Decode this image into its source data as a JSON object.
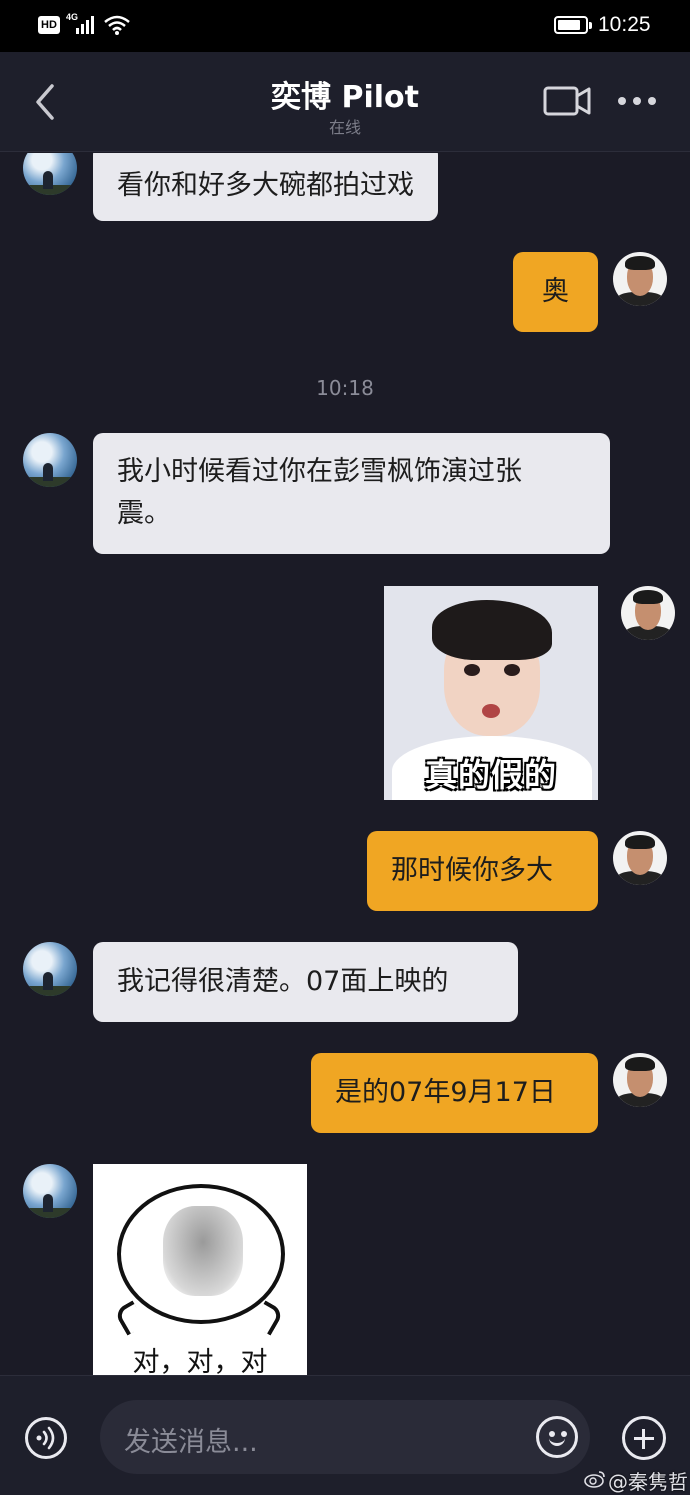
{
  "status_bar": {
    "hd": "HD",
    "network": "4G",
    "time": "10:25"
  },
  "header": {
    "title": "奕博 Pilot",
    "subtitle": "在线"
  },
  "messages": [
    {
      "side": "in",
      "type": "text",
      "text": "看你和好多大碗都拍过戏"
    },
    {
      "side": "out",
      "type": "text",
      "text": "奥"
    },
    {
      "type": "timestamp",
      "text": "10:18"
    },
    {
      "side": "in",
      "type": "text",
      "line1": "我小时候看过你在彭雪枫饰演过张",
      "line2": "震。"
    },
    {
      "side": "out",
      "type": "sticker",
      "caption": "真的假的"
    },
    {
      "side": "out",
      "type": "text",
      "text": "那时候你多大"
    },
    {
      "side": "in",
      "type": "text",
      "text": "我记得很清楚。07面上映的"
    },
    {
      "side": "out",
      "type": "text",
      "text": "是的07年9月17日"
    },
    {
      "side": "in",
      "type": "sticker",
      "caption": "对，对，对"
    }
  ],
  "input": {
    "placeholder": "发送消息..."
  },
  "watermark": "@秦隽哲",
  "colors": {
    "background": "#1b1b26",
    "incoming_bubble": "#e9e9ee",
    "outgoing_bubble": "#f0a623"
  }
}
